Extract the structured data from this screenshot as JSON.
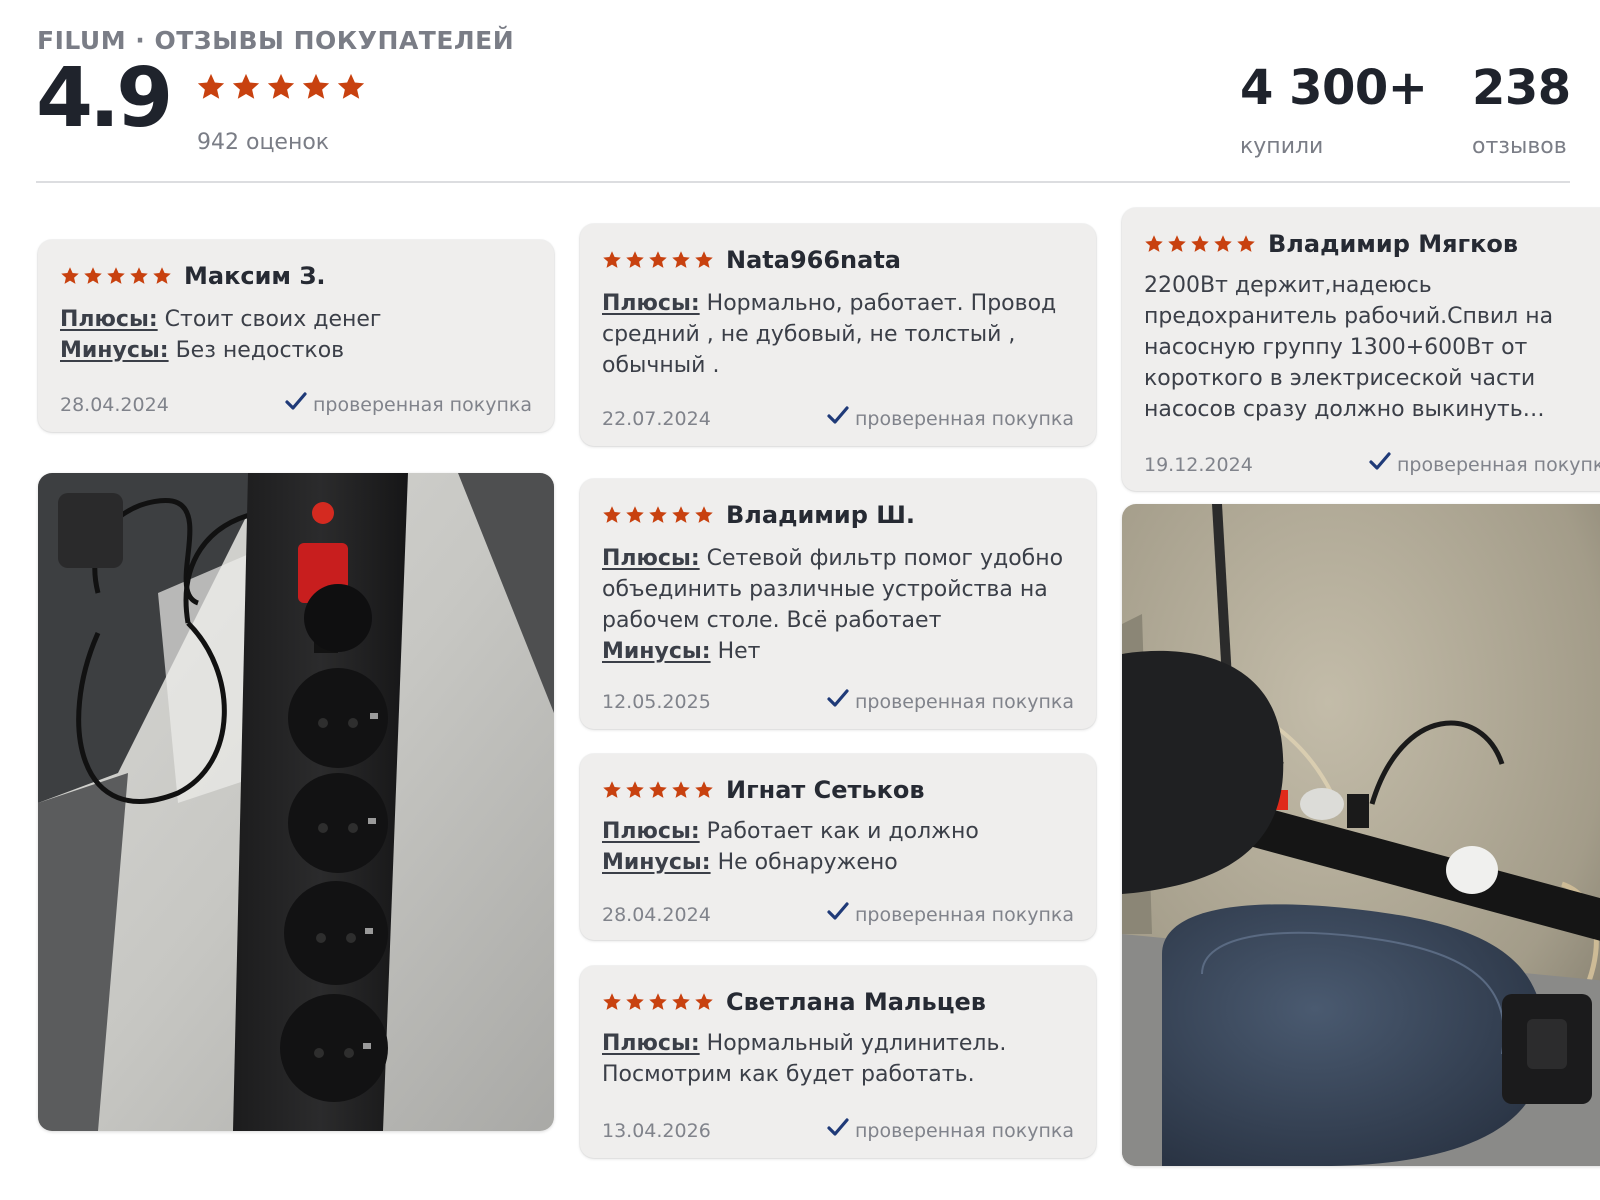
{
  "header": {
    "brand": "FILUM · ОТЗЫВЫ ПОКУПАТЕЛЕЙ",
    "rating": "4.9",
    "stars": 5,
    "ratings_count": "942 оценок",
    "bought_value": "4 300+",
    "bought_label": "купили",
    "reviews_value": "238",
    "reviews_label": "отзывов"
  },
  "colors": {
    "star": "#c8410f",
    "check": "#1f3a78",
    "card_bg": "#efeeed",
    "muted_text": "#7a7d86"
  },
  "icons": {
    "star": "star-icon",
    "verified": "checkmark-icon"
  },
  "verified_label": "проверенная покупка",
  "reviews": [
    {
      "stars": 5,
      "author": "Максим З.",
      "pros_label": "Плюсы:",
      "pros": "Стоит своих денег",
      "cons_label": "Минусы:",
      "cons": "Без недостков",
      "date": "28.04.2024"
    },
    {
      "stars": 5,
      "author": "Nata966nata",
      "pros_label": "Плюсы:",
      "pros": "Нормально, работает. Провод средний , не дубовый, не толстый , обычный .",
      "date": "22.07.2024"
    },
    {
      "stars": 5,
      "author": "Владимир Мягков",
      "text": "2200Вт держит,надеюсь предохранитель рабочий.Спвил на насосную группу 1300+600Вт от короткого в электрисеской части насосов сразу должно выкинуть…",
      "date": "19.12.2024"
    },
    {
      "stars": 5,
      "author": "Владимир Ш.",
      "pros_label": "Плюсы:",
      "pros": "Сетевой фильтр помог удобно объединить различные устройства на рабочем столе. Всё работает",
      "cons_label": "Минусы:",
      "cons": "Нет",
      "date": "12.05.2025"
    },
    {
      "stars": 5,
      "author": "Игнат Сетьков",
      "pros_label": "Плюсы:",
      "pros": "Работает как и должно",
      "cons_label": "Минусы:",
      "cons": "Не обнаружено",
      "date": "28.04.2024"
    },
    {
      "stars": 5,
      "author": "Светлана Мальцев",
      "pros_label": "Плюсы:",
      "pros": "Нормальный удлинитель. Посмотрим как будет работать.",
      "date": "13.04.2026"
    }
  ],
  "photos": [
    {
      "subject": "black power strip with red switch on white desk"
    },
    {
      "subject": "power strip under desk with plugged-in cables"
    }
  ]
}
